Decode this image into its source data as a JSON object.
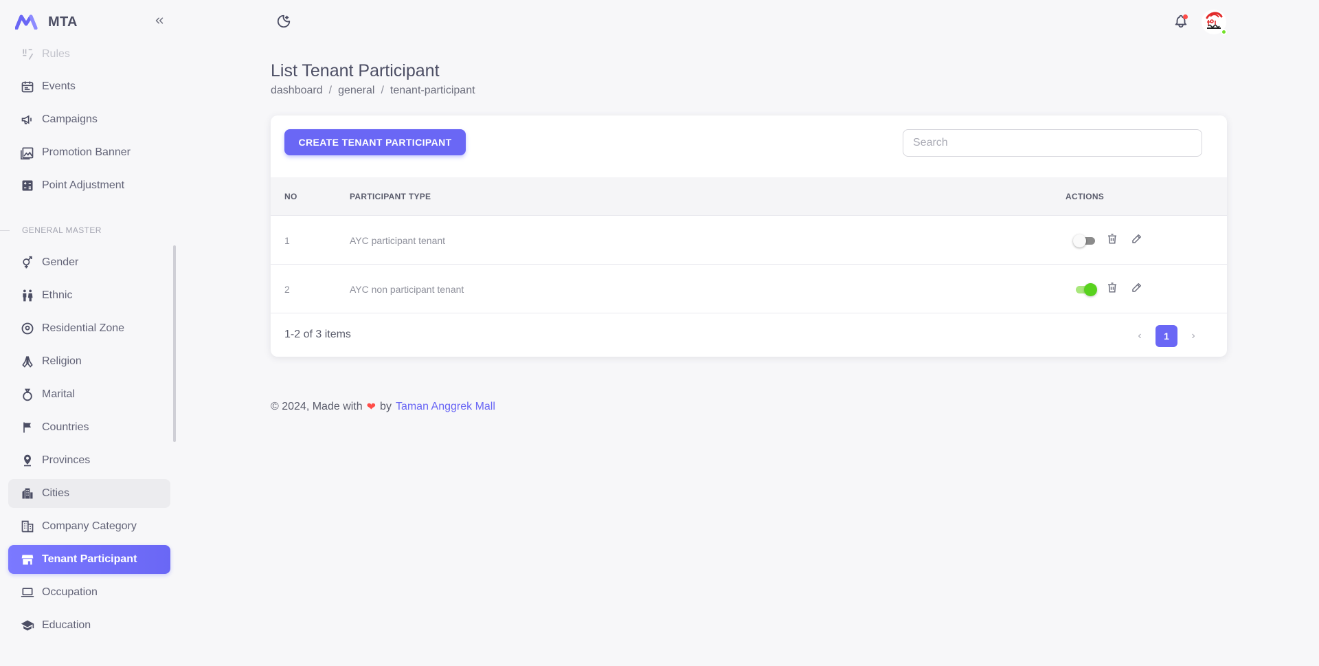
{
  "app": {
    "name": "MTA"
  },
  "sidebar": {
    "items": [
      {
        "label": "Rules",
        "icon": "rules-icon"
      },
      {
        "label": "Events",
        "icon": "calendar-icon"
      },
      {
        "label": "Campaigns",
        "icon": "megaphone-icon"
      },
      {
        "label": "Promotion Banner",
        "icon": "image-icon"
      },
      {
        "label": "Point Adjustment",
        "icon": "calculator-icon"
      }
    ],
    "section_title": "GENERAL MASTER",
    "master_items": [
      {
        "label": "Gender",
        "icon": "gender-icon"
      },
      {
        "label": "Ethnic",
        "icon": "people-icon"
      },
      {
        "label": "Residential Zone",
        "icon": "location-pin-icon"
      },
      {
        "label": "Religion",
        "icon": "praying-hands-icon"
      },
      {
        "label": "Marital",
        "icon": "ring-icon"
      },
      {
        "label": "Countries",
        "icon": "flag-icon"
      },
      {
        "label": "Provinces",
        "icon": "map-pin-icon"
      },
      {
        "label": "Cities",
        "icon": "city-icon"
      },
      {
        "label": "Company Category",
        "icon": "building-icon"
      },
      {
        "label": "Tenant Participant",
        "icon": "store-icon",
        "active": true
      },
      {
        "label": "Occupation",
        "icon": "laptop-icon"
      },
      {
        "label": "Education",
        "icon": "graduation-cap-icon"
      }
    ]
  },
  "header": {
    "title": "List Tenant Participant",
    "breadcrumb": [
      "dashboard",
      "general",
      "tenant-participant"
    ],
    "breadcrumb_separator": "/"
  },
  "toolbar": {
    "create_label": "CREATE TENANT PARTICIPANT",
    "search_placeholder": "Search"
  },
  "table": {
    "columns": [
      "NO",
      "PARTICIPANT TYPE",
      "ACTIONS"
    ],
    "rows": [
      {
        "no": "1",
        "participant_type": "AYC participant tenant",
        "active": false
      },
      {
        "no": "2",
        "participant_type": "AYC non participant tenant",
        "active": true
      }
    ]
  },
  "pagination": {
    "info": "1-2 of 3 items",
    "current_page": "1",
    "prev": "‹",
    "next": "›"
  },
  "footer": {
    "prefix": "© 2024, Made with",
    "heart": "❤",
    "by": "by",
    "link_text": "Taman Anggrek Mall"
  },
  "colors": {
    "primary": "#6a67f5",
    "switch_on": "#58d21e",
    "notification_dot": "#ff4d49",
    "online_dot": "#72e128"
  }
}
